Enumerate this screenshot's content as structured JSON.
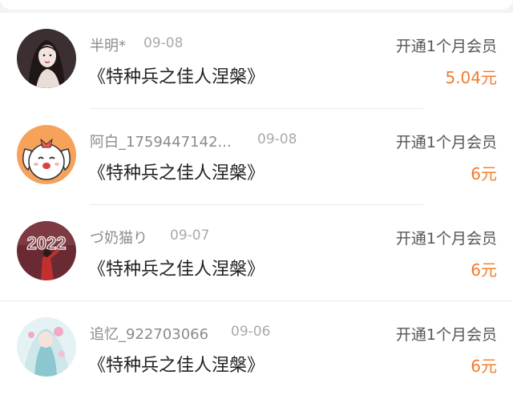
{
  "records": [
    {
      "user": "半明*",
      "date": "09-08",
      "item": "《特种兵之佳人涅槃》",
      "action": "开通1个月会员",
      "amount": "5.04元",
      "avatar": "woman-portrait-avatar"
    },
    {
      "user": "阿白_1759447142...",
      "date": "09-08",
      "item": "《特种兵之佳人涅槃》",
      "action": "开通1个月会员",
      "amount": "6元",
      "avatar": "cartoon-dog-avatar"
    },
    {
      "user": "づ奶猫り",
      "date": "09-07",
      "item": "《特种兵之佳人涅槃》",
      "action": "开通1个月会员",
      "amount": "6元",
      "avatar": "2022-photo-avatar"
    },
    {
      "user": "追忆_922703066",
      "date": "09-06",
      "item": "《特种兵之佳人涅槃》",
      "action": "开通1个月会员",
      "amount": "6元",
      "avatar": "anime-character-avatar"
    }
  ]
}
